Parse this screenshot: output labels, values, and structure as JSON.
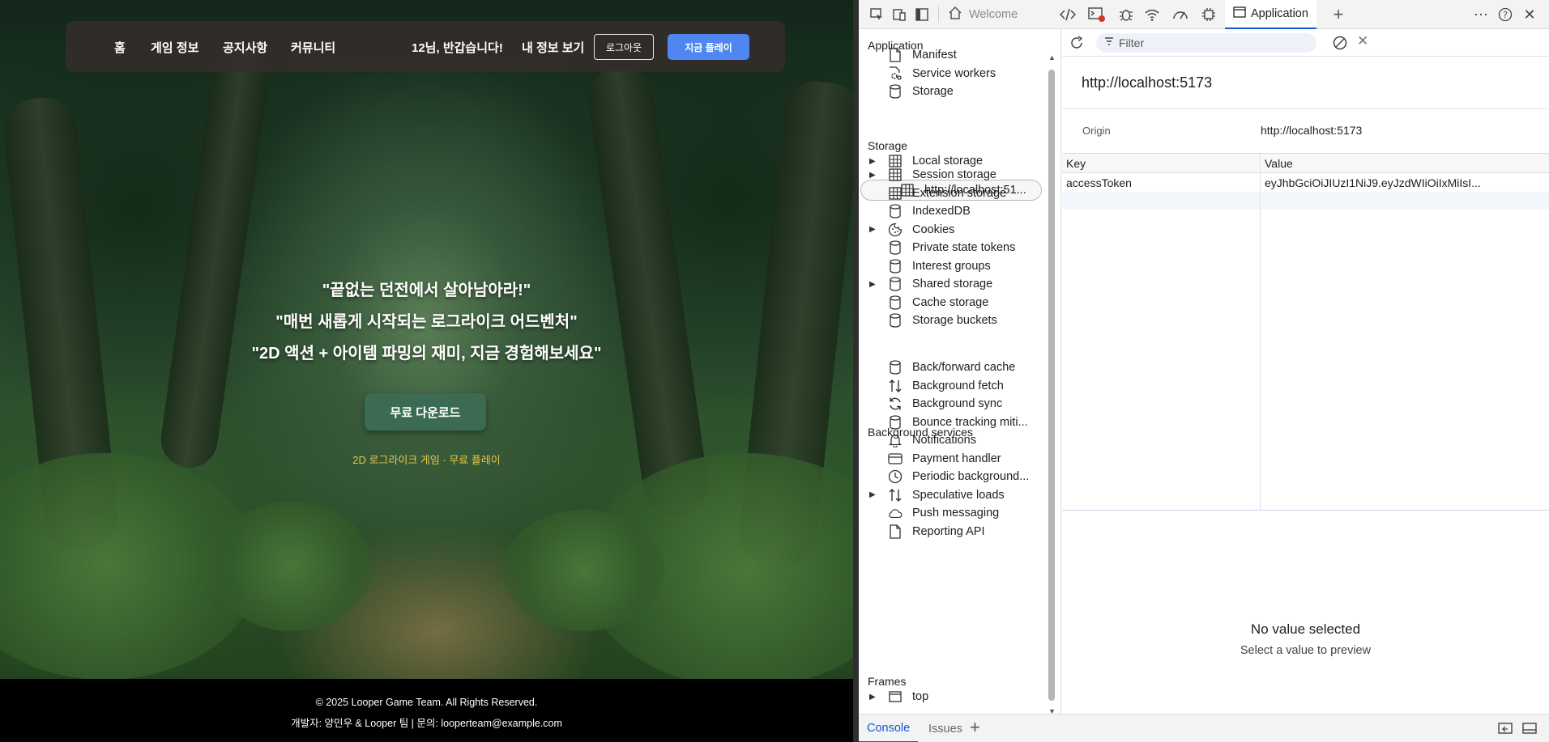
{
  "site": {
    "nav": {
      "home": "홈",
      "game_info": "게임 정보",
      "notice": "공지사항",
      "community": "커뮤니티",
      "greeting": "12님, 반갑습니다!",
      "my_info": "내 정보 보기",
      "logout": "로그아웃",
      "play_now": "지금 플레이"
    },
    "hero": {
      "line1": "\"끝없는 던전에서 살아남아라!\"",
      "line2": "\"매번 새롭게 시작되는 로그라이크 어드벤처\"",
      "line3": "\"2D 액션 + 아이템 파밍의 재미, 지금 경험해보세요\"",
      "download": "무료 다운로드",
      "tagline": "2D 로그라이크 게임 · 무료 플레이"
    },
    "footer": {
      "copyright": "© 2025 Looper Game Team. All Rights Reserved.",
      "contact": "개발자: 양민우 & Looper 팀 | 문의: looperteam@example.com"
    },
    "colors": {
      "accent_button": "#4f86f2",
      "download_button": "#3b6b52",
      "tagline": "#e6c84a"
    }
  },
  "devtools": {
    "tabs": {
      "welcome": "Welcome",
      "application": "Application"
    },
    "filter_placeholder": "Filter",
    "sidebar": {
      "application_header": "Application",
      "application_items": [
        {
          "label": "Manifest",
          "icon": "document-icon"
        },
        {
          "label": "Service workers",
          "icon": "gears-icon"
        },
        {
          "label": "Storage",
          "icon": "database-icon"
        }
      ],
      "storage_header": "Storage",
      "local_storage": "Local storage",
      "local_origin": "http://localhost:51...",
      "storage_items": [
        {
          "label": "Session storage",
          "icon": "grid-icon",
          "expandable": true
        },
        {
          "label": "Extension storage",
          "icon": "grid-icon",
          "expandable": false
        },
        {
          "label": "IndexedDB",
          "icon": "database-icon",
          "expandable": false
        },
        {
          "label": "Cookies",
          "icon": "cookie-icon",
          "expandable": true
        },
        {
          "label": "Private state tokens",
          "icon": "database-icon",
          "expandable": false
        },
        {
          "label": "Interest groups",
          "icon": "database-icon",
          "expandable": false
        },
        {
          "label": "Shared storage",
          "icon": "database-icon",
          "expandable": true
        },
        {
          "label": "Cache storage",
          "icon": "database-icon",
          "expandable": false
        },
        {
          "label": "Storage buckets",
          "icon": "database-icon",
          "expandable": false
        }
      ],
      "background_header": "Background services",
      "background_items": [
        {
          "label": "Back/forward cache",
          "icon": "database-icon",
          "expandable": false
        },
        {
          "label": "Background fetch",
          "icon": "updown-arrows-icon",
          "expandable": false
        },
        {
          "label": "Background sync",
          "icon": "sync-icon",
          "expandable": false
        },
        {
          "label": "Bounce tracking miti...",
          "icon": "database-icon",
          "expandable": false
        },
        {
          "label": "Notifications",
          "icon": "bell-icon",
          "expandable": false
        },
        {
          "label": "Payment handler",
          "icon": "card-icon",
          "expandable": false
        },
        {
          "label": "Periodic background...",
          "icon": "clock-icon",
          "expandable": false
        },
        {
          "label": "Speculative loads",
          "icon": "updown-arrows-icon",
          "expandable": true
        },
        {
          "label": "Push messaging",
          "icon": "cloud-icon",
          "expandable": false
        },
        {
          "label": "Reporting API",
          "icon": "document-icon",
          "expandable": false
        }
      ],
      "frames_header": "Frames",
      "frames_top": "top"
    },
    "main": {
      "origin_title": "http://localhost:5173",
      "origin_label": "Origin",
      "origin_value": "http://localhost:5173",
      "columns": {
        "key": "Key",
        "value": "Value"
      },
      "rows": [
        {
          "key": "accessToken",
          "value": "eyJhbGciOiJIUzI1NiJ9.eyJzdWIiOiIxMiIsI..."
        }
      ],
      "preview_title": "No value selected",
      "preview_sub": "Select a value to preview"
    },
    "drawer": {
      "console": "Console",
      "issues": "Issues"
    },
    "colors": {
      "accent": "#0b5cd6"
    }
  }
}
